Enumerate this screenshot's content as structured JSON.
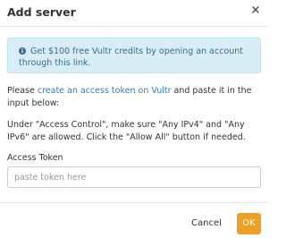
{
  "dialog": {
    "title": "Add server",
    "close_symbol": "×",
    "colors": {
      "info_bg": "#d9edf7",
      "info_text": "#31708f",
      "link": "#2a7ec9",
      "ok_button": "#f0a020"
    }
  },
  "info_banner": {
    "icon": "info-circle-icon",
    "icon_glyph": "i",
    "text": "Get $100 free Vultr credits by opening an account through",
    "link_text": "this link",
    "suffix": "."
  },
  "instructions": {
    "p1_before": "Please ",
    "p1_link": "create an access token on Vultr",
    "p1_after": " and paste it in the input below:",
    "p2": "Under \"Access Control\", make sure \"Any IPv4\" and \"Any IPv6\" are allowed. Click the \"Allow All\" button if needed."
  },
  "token_field": {
    "label": "Access Token",
    "placeholder": "paste token here",
    "value": ""
  },
  "footer": {
    "cancel_label": "Cancel",
    "ok_label": "OK"
  }
}
